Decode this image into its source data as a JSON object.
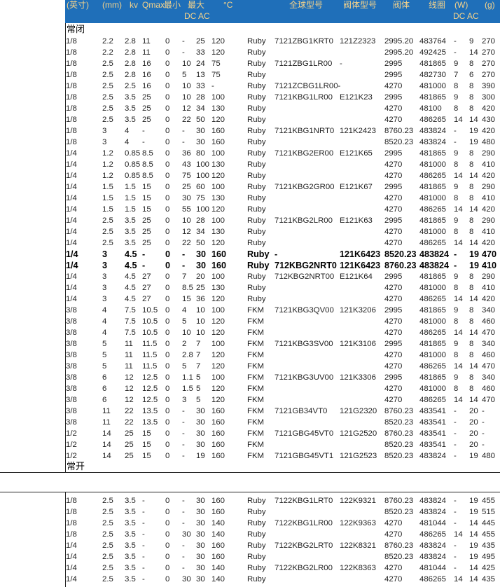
{
  "header_line1": [
    "(英寸)",
    "(mm)",
    "kv",
    "Qmax",
    "最小",
    "最大",
    "°C",
    "全球型号",
    "阀体型号",
    "阀体",
    "线圈",
    "(W)",
    "(g)"
  ],
  "header_line2": [
    "DC AC",
    "DC AC"
  ],
  "section_nc": "常闭",
  "section_no": "常开",
  "rows_nc": [
    [
      "1/8",
      "2.2",
      "2.8",
      "11",
      "0",
      "-",
      "25",
      "120",
      "Ruby",
      "7121ZBG1KRT0",
      "121Z2323",
      "2995.20",
      "483764",
      "-",
      "9",
      "270"
    ],
    [
      "1/8",
      "2.2",
      "2.8",
      "11",
      "0",
      "-",
      "33",
      "120",
      "Ruby",
      "",
      "",
      "2995.20",
      "492425",
      "-",
      "14",
      "270"
    ],
    [
      "1/8",
      "2.5",
      "2.8",
      "16",
      "0",
      "10",
      "24",
      "75",
      "Ruby",
      "7121ZBG1LR00",
      "-",
      "2995",
      "481865",
      "9",
      "8",
      "270"
    ],
    [
      "1/8",
      "2.5",
      "2.8",
      "16",
      "0",
      "5",
      "13",
      "75",
      "Ruby",
      "",
      "",
      "2995",
      "482730",
      "7",
      "6",
      "270"
    ],
    [
      "1/8",
      "2.5",
      "2.5",
      "16",
      "0",
      "10",
      "33",
      "-",
      "Ruby",
      "7121ZCBG1LR00-",
      "",
      "4270",
      "481000",
      "8",
      "8",
      "390"
    ],
    [
      "1/8",
      "2.5",
      "3.5",
      "25",
      "0",
      "10",
      "28",
      "100",
      "Ruby",
      "7121KBG1LR00",
      "E121K23",
      "2995",
      "481865",
      "9",
      "8",
      "300"
    ],
    [
      "1/8",
      "2.5",
      "3.5",
      "25",
      "0",
      "12",
      "34",
      "130",
      "Ruby",
      "",
      "",
      "4270",
      "48100",
      "8",
      "8",
      "420"
    ],
    [
      "1/8",
      "2.5",
      "3.5",
      "25",
      "0",
      "22",
      "50",
      "120",
      "Ruby",
      "",
      "",
      "4270",
      "486265",
      "14",
      "14",
      "430"
    ],
    [
      "1/8",
      "3",
      "4",
      "-",
      "0",
      "-",
      "30",
      "160",
      "Ruby",
      "7121KBG1NRT0",
      "121K2423",
      "8760.23",
      "483824",
      "-",
      "19",
      "420"
    ],
    [
      "1/8",
      "3",
      "4",
      "-",
      "0",
      "-",
      "30",
      "160",
      "Ruby",
      "",
      "",
      "8520.23",
      "483824",
      "-",
      "19",
      "480"
    ],
    [
      "1/4",
      "1.2",
      "0.85",
      "8.5",
      "0",
      "36",
      "80",
      "100",
      "Ruby",
      "7121KBG2ER00",
      "E121K65",
      "2995",
      "481865",
      "9",
      "8",
      "290"
    ],
    [
      "1/4",
      "1.2",
      "0.85",
      "8.5",
      "0",
      "43",
      "100",
      "130",
      "Ruby",
      "",
      "",
      "4270",
      "481000",
      "8",
      "8",
      "410"
    ],
    [
      "1/4",
      "1.2",
      "0.85",
      "8.5",
      "0",
      "75",
      "100",
      "120",
      "Ruby",
      "",
      "",
      "4270",
      "486265",
      "14",
      "14",
      "420"
    ],
    [
      "1/4",
      "1.5",
      "1.5",
      "15",
      "0",
      "25",
      "60",
      "100",
      "Ruby",
      "7121KBG2GR00",
      "E121K67",
      "2995",
      "481865",
      "9",
      "8",
      "290"
    ],
    [
      "1/4",
      "1.5",
      "1.5",
      "15",
      "0",
      "30",
      "75",
      "130",
      "Ruby",
      "",
      "",
      "4270",
      "481000",
      "8",
      "8",
      "410"
    ],
    [
      "1/4",
      "1.5",
      "1.5",
      "15",
      "0",
      "55",
      "100",
      "120",
      "Ruby",
      "",
      "",
      "4270",
      "486265",
      "14",
      "14",
      "420"
    ],
    [
      "1/4",
      "2.5",
      "3.5",
      "25",
      "0",
      "10",
      "28",
      "100",
      "Ruby",
      "7121KBG2LR00",
      "E121K63",
      "2995",
      "481865",
      "9",
      "8",
      "290"
    ],
    [
      "1/4",
      "2.5",
      "3.5",
      "25",
      "0",
      "12",
      "34",
      "130",
      "Ruby",
      "",
      "",
      "4270",
      "481000",
      "8",
      "8",
      "410"
    ],
    [
      "1/4",
      "2.5",
      "3.5",
      "25",
      "0",
      "22",
      "50",
      "120",
      "Ruby",
      "",
      "",
      "4270",
      "486265",
      "14",
      "14",
      "420"
    ],
    [
      "1/4",
      "3",
      "4.5",
      "-",
      "0",
      "-",
      "30",
      "160",
      "Ruby",
      "-",
      "121K6423",
      "8520.23",
      "483824",
      "-",
      "19",
      "470",
      "bold"
    ],
    [
      "1/4",
      "3",
      "4.5",
      "-",
      "0",
      "-",
      "30",
      "160",
      "Ruby",
      "712KBG2NRT0",
      "121K6423",
      "8760.23",
      "483824",
      "-",
      "19",
      "410",
      "bold"
    ],
    [
      "1/4",
      "3",
      "4.5",
      "27",
      "0",
      "7",
      "20",
      "100",
      "Ruby",
      "712KBG2NRT00",
      "E121K64",
      "2995",
      "481865",
      "9",
      "8",
      "290"
    ],
    [
      "1/4",
      "3",
      "4.5",
      "27",
      "0",
      "8.5",
      "25",
      "130",
      "Ruby",
      "",
      "",
      "4270",
      "481000",
      "8",
      "8",
      "410"
    ],
    [
      "1/4",
      "3",
      "4.5",
      "27",
      "0",
      "15",
      "36",
      "120",
      "Ruby",
      "",
      "",
      "4270",
      "486265",
      "14",
      "14",
      "420"
    ],
    [
      "3/8",
      "4",
      "7.5",
      "10.5",
      "0",
      "4",
      "10",
      "100",
      "FKM",
      "7121KBG3QV00",
      "121K3206",
      "2995",
      "481865",
      "9",
      "8",
      "340"
    ],
    [
      "3/8",
      "4",
      "7.5",
      "10.5",
      "0",
      "5",
      "10",
      "120",
      "FKM",
      "",
      "",
      "4270",
      "481000",
      "8",
      "8",
      "460"
    ],
    [
      "3/8",
      "4",
      "7.5",
      "10.5",
      "0",
      "10",
      "10",
      "120",
      "FKM",
      "",
      "",
      "4270",
      "486265",
      "14",
      "14",
      "470"
    ],
    [
      "3/8",
      "5",
      "11",
      "11.5",
      "0",
      "2",
      "7",
      "100",
      "FKM",
      "7121KBG3SV00",
      "121K3106",
      "2995",
      "481865",
      "9",
      "8",
      "340"
    ],
    [
      "3/8",
      "5",
      "11",
      "11.5",
      "0",
      "2.8",
      "7",
      "120",
      "FKM",
      "",
      "",
      "4270",
      "481000",
      "8",
      "8",
      "460"
    ],
    [
      "3/8",
      "5",
      "11",
      "11.5",
      "0",
      "5",
      "7",
      "120",
      "FKM",
      "",
      "",
      "4270",
      "486265",
      "14",
      "14",
      "470"
    ],
    [
      "3/8",
      "6",
      "12",
      "12.5",
      "0",
      "1.1",
      "5",
      "100",
      "FKM",
      "7121KBG3UV00",
      "121K3306",
      "2995",
      "481865",
      "9",
      "8",
      "340"
    ],
    [
      "3/8",
      "6",
      "12",
      "12.5",
      "0",
      "1.5",
      "5",
      "120",
      "FKM",
      "",
      "",
      "4270",
      "481000",
      "8",
      "8",
      "460"
    ],
    [
      "3/8",
      "6",
      "12",
      "12.5",
      "0",
      "3",
      "5",
      "120",
      "FKM",
      "",
      "",
      "4270",
      "486265",
      "14",
      "14",
      "470"
    ],
    [
      "3/8",
      "11",
      "22",
      "13.5",
      "0",
      "-",
      "30",
      "160",
      "FKM",
      "7121GB34VT0",
      "121G2320",
      "8760.23",
      "483541",
      "-",
      "20",
      "-"
    ],
    [
      "3/8",
      "11",
      "22",
      "13.5",
      "0",
      "-",
      "30",
      "160",
      "FKM",
      "",
      "",
      "8520.23",
      "483541",
      "-",
      "20",
      "-"
    ],
    [
      "1/2",
      "14",
      "25",
      "15",
      "0",
      "-",
      "30",
      "160",
      "FKM",
      "7121GBG45VT0",
      "121G2520",
      "8760.23",
      "483541",
      "-",
      "20",
      "-"
    ],
    [
      "1/2",
      "14",
      "25",
      "15",
      "0",
      "-",
      "30",
      "160",
      "FKM",
      "",
      "",
      "8520.23",
      "483541",
      "-",
      "20",
      "-"
    ],
    [
      "1/2",
      "14",
      "25",
      "15",
      "0",
      "-",
      "19",
      "160",
      "FKM",
      "7121GBG45VT1",
      "121G2523",
      "8520.23",
      "483824",
      "-",
      "19",
      "480"
    ]
  ],
  "rows_no": [
    [
      "1/8",
      "2.5",
      "3.5",
      "-",
      "0",
      "-",
      "30",
      "160",
      "Ruby",
      "7122KBG1LRT0",
      "122K9321",
      "8760.23",
      "483824",
      "-",
      "19",
      "455"
    ],
    [
      "1/8",
      "2.5",
      "3.5",
      "-",
      "0",
      "-",
      "30",
      "160",
      "Ruby",
      "",
      "",
      "8520.23",
      "483824",
      "-",
      "19",
      "515"
    ],
    [
      "1/8",
      "2.5",
      "3.5",
      "-",
      "0",
      "-",
      "30",
      "140",
      "Ruby",
      "7122KBG1LR00",
      "122K9363",
      "4270",
      "481044",
      "-",
      "14",
      "445"
    ],
    [
      "1/8",
      "2.5",
      "3.5",
      "-",
      "0",
      "30",
      "30",
      "140",
      "Ruby",
      "",
      "",
      "4270",
      "486265",
      "14",
      "14",
      "455"
    ],
    [
      "1/4",
      "2.5",
      "3.5",
      "-",
      "0",
      "-",
      "30",
      "160",
      "Ruby",
      "7122KBG2LRT0",
      "122K8321",
      "8760.23",
      "483824",
      "-",
      "19",
      "435"
    ],
    [
      "1/4",
      "2.5",
      "3.5",
      "-",
      "0",
      "-",
      "30",
      "160",
      "Ruby",
      "",
      "",
      "8520.23",
      "483824",
      "-",
      "19",
      "495"
    ],
    [
      "1/4",
      "2.5",
      "3.5",
      "-",
      "0",
      "-",
      "30",
      "140",
      "Ruby",
      "7122KBG2LR00",
      "122K8363",
      "4270",
      "481044",
      "-",
      "14",
      "425"
    ],
    [
      "1/4",
      "2.5",
      "3.5",
      "-",
      "0",
      "30",
      "30",
      "140",
      "Ruby",
      "",
      "",
      "4270",
      "486265",
      "14",
      "14",
      "435"
    ]
  ]
}
